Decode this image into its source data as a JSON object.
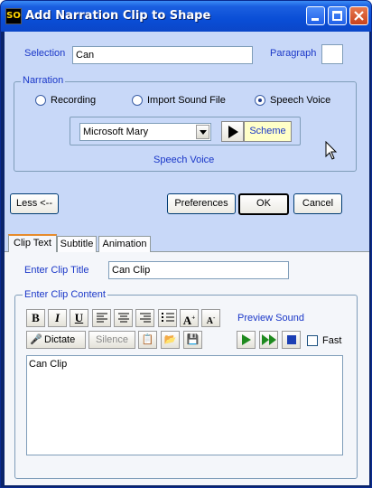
{
  "window": {
    "title": "Add Narration Clip to Shape",
    "app_icon": "SO"
  },
  "top": {
    "selection_label": "Selection",
    "selection_value": "Can",
    "paragraph_label": "Paragraph",
    "paragraph_value": ""
  },
  "narration": {
    "group_label": "Narration",
    "options": [
      {
        "label": "Recording",
        "selected": false
      },
      {
        "label": "Import Sound File",
        "selected": false
      },
      {
        "label": "Speech Voice",
        "selected": true
      }
    ],
    "voice_selected": "Microsoft Mary",
    "scheme_label": "Scheme",
    "speech_voice_label": "Speech Voice"
  },
  "buttons": {
    "less": "Less <--",
    "preferences": "Preferences",
    "ok": "OK",
    "cancel": "Cancel"
  },
  "tabs": [
    {
      "label": "Clip Text",
      "selected": true
    },
    {
      "label": "Subtitle",
      "selected": false
    },
    {
      "label": "Animation",
      "selected": false
    }
  ],
  "clip": {
    "title_label": "Enter Clip Title",
    "title_value": "Can Clip",
    "content_label": "Enter Clip Content",
    "preview_label": "Preview Sound",
    "dictate_label": "Dictate",
    "silence_label": "Silence",
    "fast_label": "Fast",
    "fast_checked": false,
    "content_value": "Can Clip"
  },
  "colors": {
    "accent_label": "#1a37c8",
    "client_bg": "#c8d8f8",
    "title_bar": "#0a4ed6"
  }
}
